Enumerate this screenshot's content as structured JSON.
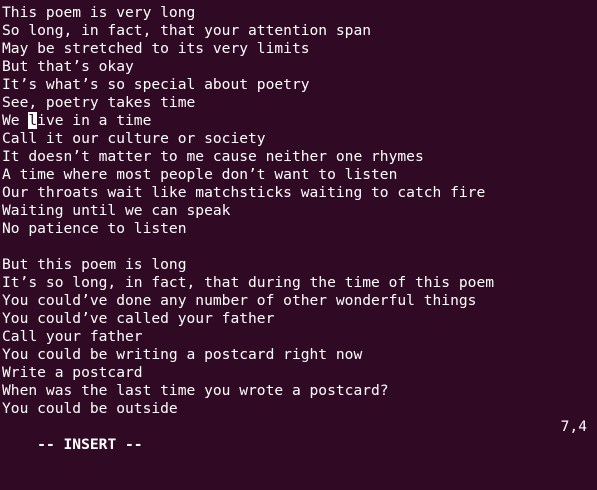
{
  "editor": {
    "lines": [
      "This poem is very long",
      "So long, in fact, that your attention span",
      "May be stretched to its very limits",
      "But that’s okay",
      "It’s what’s so special about poetry",
      "See, poetry takes time",
      "We live in a time",
      "Call it our culture or society",
      "It doesn’t matter to me cause neither one rhymes",
      "A time where most people don’t want to listen",
      "Our throats wait like matchsticks waiting to catch fire",
      "Waiting until we can speak",
      "No patience to listen",
      "",
      "But this poem is long",
      "It’s so long, in fact, that during the time of this poem",
      "You could’ve done any number of other wonderful things",
      "You could’ve called your father",
      "Call your father",
      "You could be writing a postcard right now",
      "Write a postcard",
      "When was the last time you wrote a postcard?",
      "You could be outside"
    ],
    "cursor_line_number": 7,
    "cursor_before": "We ",
    "cursor_char": "l",
    "cursor_after": "ive in a time"
  },
  "status": {
    "mode": "-- INSERT --",
    "position": "7,4"
  },
  "colors": {
    "background": "#300a24",
    "foreground": "#ffffff",
    "cursor": "#ffffff"
  }
}
